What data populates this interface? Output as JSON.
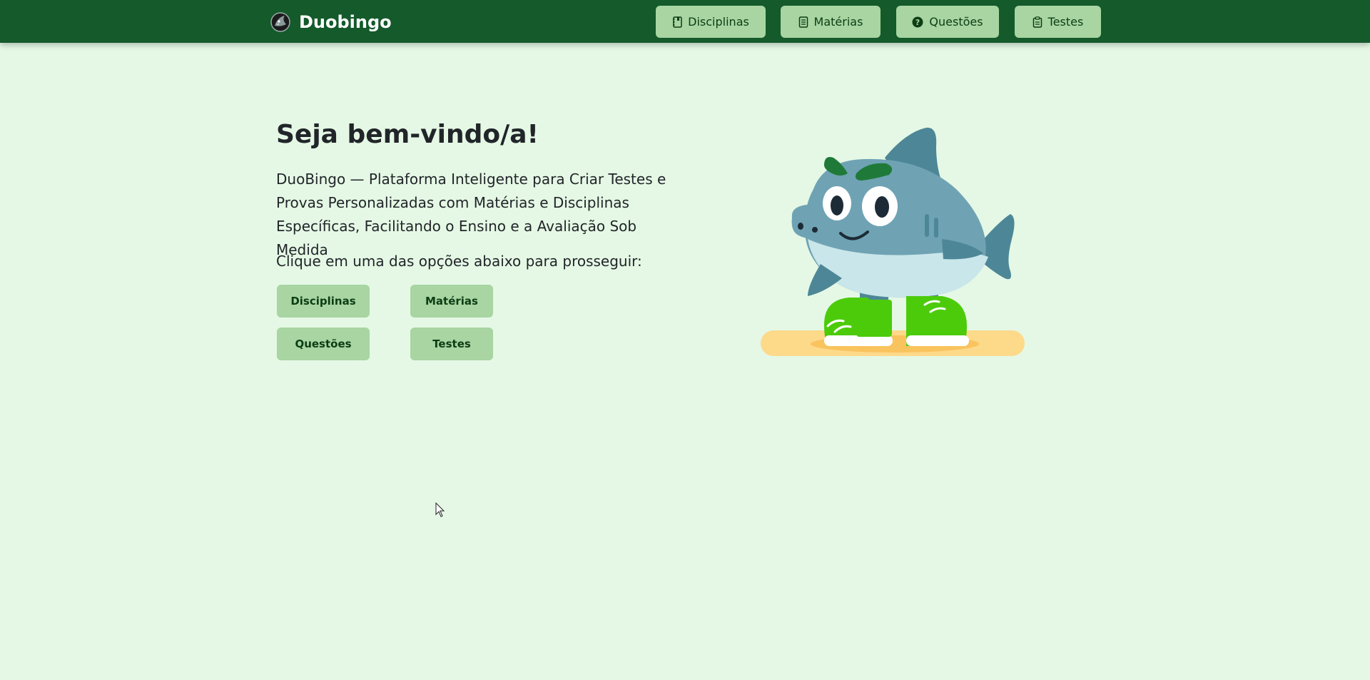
{
  "app": {
    "brand_name": "Duobingo"
  },
  "nav": {
    "items": [
      {
        "label": "Disciplinas",
        "icon": "notebook-icon"
      },
      {
        "label": "Matérias",
        "icon": "document-list-icon"
      },
      {
        "label": "Questões",
        "icon": "question-circle-icon"
      },
      {
        "label": "Testes",
        "icon": "clipboard-icon"
      }
    ]
  },
  "hero": {
    "title": "Seja bem-vindo/a!",
    "description": "DuoBingo — Plataforma Inteligente para Criar Testes e Provas Personalizadas com Matérias e Disciplinas Específicas, Facilitando o Ensino e a Avaliação Sob Medida",
    "prompt": "Clique em uma das opções abaixo para prosseguir:"
  },
  "options": {
    "disciplinas": "Disciplinas",
    "materias": "Matérias",
    "questoes": "Questões",
    "testes": "Testes"
  },
  "colors": {
    "navbar": "#145a2b",
    "page_background": "#e5f8e5",
    "button": "#a8d5a2",
    "button_text": "#0c3d13",
    "mascot_body": "#6fa3b4",
    "mascot_shoes": "#4ccb0b"
  }
}
